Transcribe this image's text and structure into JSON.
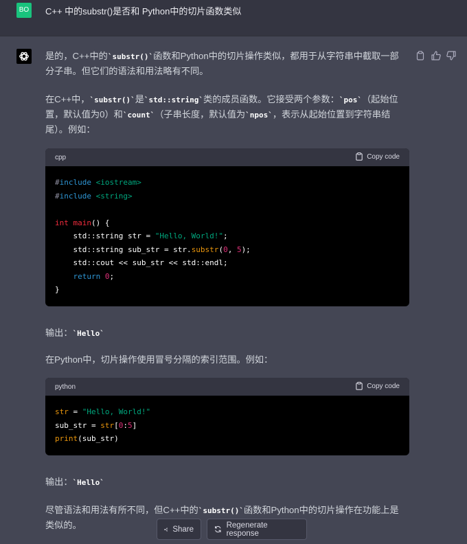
{
  "user": {
    "avatar_initials": "BO",
    "question": "C++ 中的substr()是否和 Python中的切片函数类似"
  },
  "answer": {
    "p1_a": "是的，C++中的",
    "p1_code": "`substr()`",
    "p1_b": "函数和Python中的切片操作类似，都用于从字符串中截取一部分子串。但它们的语法和用法略有不同。",
    "p2_a": "在C++中，",
    "p2_code1": "`substr()`",
    "p2_b": "是",
    "p2_code2": "`std::string`",
    "p2_c": "类的成员函数。它接受两个参数：",
    "p2_code3": "`pos`",
    "p2_d": "（起始位置，默认值为0）和",
    "p2_code4": "`count`",
    "p2_e": "（子串长度，默认值为",
    "p2_code5": "`npos`",
    "p2_f": "，表示从起始位置到字符串结尾）。例如：",
    "out1_label": "输出：",
    "out1_code": "`Hello`",
    "p3": "在Python中，切片操作使用冒号分隔的索引范围。例如：",
    "out2_label": "输出：",
    "out2_code": "`Hello`",
    "p4_a": "尽管语法和用法有所不同，但C++中的",
    "p4_code": "`substr()`",
    "p4_b": "函数和Python中的切片操作在功能上是类似的。"
  },
  "code_blocks": [
    {
      "lang": "cpp",
      "copy_label": "Copy code",
      "lines": [
        [
          [
            "c-pp",
            "#"
          ],
          [
            "c-inc",
            "include"
          ],
          [
            "",
            " "
          ],
          [
            "c-str",
            "<iostream>"
          ]
        ],
        [
          [
            "c-pp",
            "#"
          ],
          [
            "c-inc",
            "include"
          ],
          [
            "",
            " "
          ],
          [
            "c-str",
            "<string>"
          ]
        ],
        [
          [
            "",
            ""
          ]
        ],
        [
          [
            "c-kw",
            "int"
          ],
          [
            "",
            ""
          ],
          [
            "",
            " "
          ],
          [
            "c-fn",
            "main"
          ],
          [
            "",
            "() {"
          ]
        ],
        [
          [
            "",
            "    std::string str = "
          ],
          [
            "c-str",
            "\"Hello, World!\""
          ],
          [
            "",
            ";"
          ]
        ],
        [
          [
            "",
            "    std::string sub_str = str."
          ],
          [
            "c-mth",
            "substr"
          ],
          [
            "",
            "("
          ],
          [
            "c-num",
            "0"
          ],
          [
            "",
            ", "
          ],
          [
            "c-num",
            "5"
          ],
          [
            "",
            ");"
          ]
        ],
        [
          [
            "",
            "    std::cout << sub_str << std::endl;"
          ]
        ],
        [
          [
            "",
            "    "
          ],
          [
            "c-ret",
            "return"
          ],
          [
            "",
            " "
          ],
          [
            "c-num",
            "0"
          ],
          [
            "",
            ";"
          ]
        ],
        [
          [
            "",
            "}"
          ]
        ]
      ]
    },
    {
      "lang": "python",
      "copy_label": "Copy code",
      "lines": [
        [
          [
            "c-mth",
            "str"
          ],
          [
            "",
            " = "
          ],
          [
            "c-str",
            "\"Hello, World!\""
          ]
        ],
        [
          [
            "",
            "sub_str = "
          ],
          [
            "c-mth",
            "str"
          ],
          [
            "",
            "["
          ],
          [
            "c-num",
            "0"
          ],
          [
            "",
            ":"
          ],
          [
            "c-num",
            "5"
          ],
          [
            "",
            "]"
          ]
        ],
        [
          [
            "c-mth",
            "print"
          ],
          [
            "",
            "(sub_str)"
          ]
        ]
      ]
    }
  ],
  "buttons": {
    "share": "Share",
    "regenerate": "Regenerate response"
  },
  "colors": {
    "accent_user": "#19c37d",
    "bg_answer": "#444654",
    "bg_question": "#343541"
  }
}
